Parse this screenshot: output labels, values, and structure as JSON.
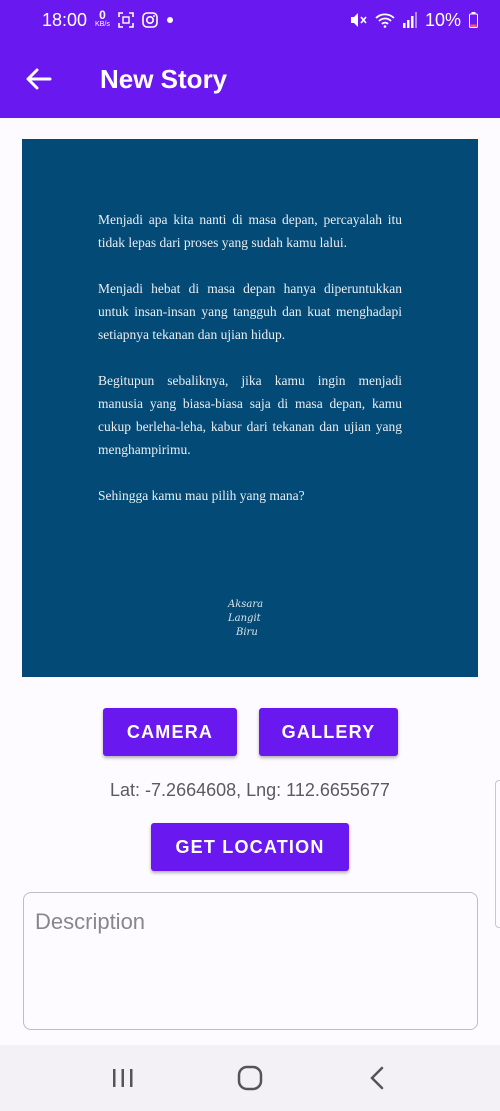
{
  "status_bar": {
    "time": "18:00",
    "data_speed_value": "0",
    "data_speed_unit": "KB/s",
    "battery": "10%",
    "icons": [
      "data-speed-icon",
      "screenshot-icon",
      "instagram-icon",
      "dot-icon",
      "mute-icon",
      "wifi-icon",
      "signal-icon",
      "battery-icon"
    ]
  },
  "app_bar": {
    "title": "New Story",
    "back_icon": "arrow-back-icon"
  },
  "story_image": {
    "paragraphs": [
      "Menjadi apa kita nanti di masa depan, percayalah itu tidak lepas dari proses yang sudah kamu lalui.",
      "Menjadi hebat di masa depan hanya diperuntukkan untuk insan-insan yang tangguh dan kuat menghadapi setiapnya tekanan dan ujian hidup.",
      "Begitupun sebaliknya, jika kamu ingin menjadi manusia yang biasa-biasa saja di masa depan, kamu cukup berleha-leha, kabur dari tekanan dan ujian yang menghampirimu.",
      "Sehingga kamu mau pilih yang mana?"
    ],
    "signature_lines": [
      "Aksara",
      "Langit",
      "Biru"
    ],
    "background_color": "#034a76"
  },
  "buttons": {
    "camera": "CAMERA",
    "gallery": "GALLERY",
    "get_location": "GET LOCATION"
  },
  "location": {
    "text": "Lat: -7.2664608, Lng: 112.6655677"
  },
  "description": {
    "placeholder": "Description",
    "value": ""
  },
  "nav_bar": {
    "icons": [
      "recent-apps-icon",
      "home-icon",
      "back-icon"
    ]
  },
  "colors": {
    "primary": "#6a18f0",
    "background": "#fdfbff"
  }
}
